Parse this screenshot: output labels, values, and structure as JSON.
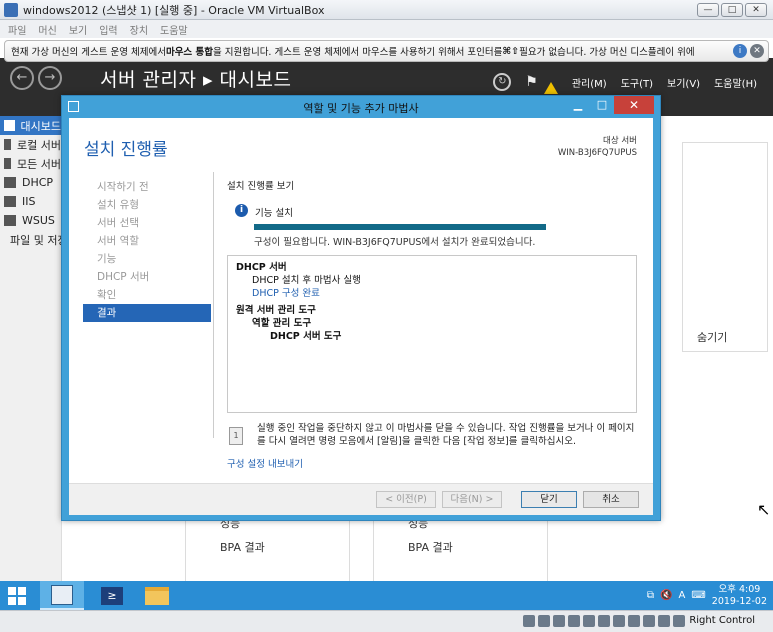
{
  "host": {
    "title": "windows2012 (스냅샷 1) [실행 중] - Oracle VM VirtualBox",
    "menu": [
      "파일",
      "머신",
      "보기",
      "입력",
      "장치",
      "도움말"
    ],
    "hostkey": "Right Control"
  },
  "notice": {
    "text_a": "현재 가상 머신의 게스트 운영 체제에서 ",
    "bold": "마우스 통합",
    "text_b": "을 지원합니다. 게스트 운영 체제에서 마우스를 사용하기 위해서 포인터를 ",
    "text_c": " 필요가 없습니다. 가상 머신 디스플레이 위에"
  },
  "server_manager": {
    "title": "서버 관리자 ▸ 대시보드",
    "tools": [
      "관리(M)",
      "도구(T)",
      "보기(V)",
      "도움말(H)"
    ],
    "sidebar": [
      "대시보드",
      "로컬 서버",
      "모든 서버",
      "DHCP",
      "IIS",
      "WSUS",
      "파일 및 저장소 서비스"
    ],
    "hide_label": "숨기기",
    "tile_labels": [
      "성능",
      "BPA 결과",
      "성능",
      "BPA 결과"
    ]
  },
  "wizard": {
    "window_title": "역할 및 기능 추가 마법사",
    "heading": "설치 진행률",
    "target_label": "대상 서버",
    "target_server": "WIN-B3J6FQ7UPUS",
    "steps": [
      "시작하기 전",
      "설치 유형",
      "서버 선택",
      "서버 역할",
      "기능",
      "DHCP 서버",
      "확인",
      "결과"
    ],
    "current_step": "결과",
    "section_title": "설치 진행률 보기",
    "status_label": "기능 설치",
    "progress": 1.0,
    "done_message": "구성이 필요합니다. WIN-B3J6FQ7UPUS에서 설치가 완료되었습니다.",
    "results": [
      {
        "text": "DHCP 서버",
        "level": 0,
        "style": "bold"
      },
      {
        "text": "DHCP 설치 후 마법사 실행",
        "level": 1,
        "style": "normal"
      },
      {
        "text": "DHCP 구성 완료",
        "level": 1,
        "style": "link"
      },
      {
        "text": "원격 서버 관리 도구",
        "level": 0,
        "style": "bold"
      },
      {
        "text": "역할 관리 도구",
        "level": 1,
        "style": "bold"
      },
      {
        "text": "DHCP 서버 도구",
        "level": 2,
        "style": "bold"
      }
    ],
    "note": "실행 중인 작업을 중단하지 않고 이 마법사를 닫을 수 있습니다. 작업 진행률을 보거나 이 페이지를 다시 열려면 명령 모음에서 [알림]을 클릭한 다음 [작업 정보]를 클릭하십시오.",
    "export_link": "구성 설정 내보내기",
    "buttons": {
      "prev": "< 이전(P)",
      "next": "다음(N) >",
      "close": "닫기",
      "cancel": "취소"
    }
  },
  "taskbar": {
    "time": "오후 4:09",
    "date": "2019-12-02",
    "ime": "A"
  }
}
